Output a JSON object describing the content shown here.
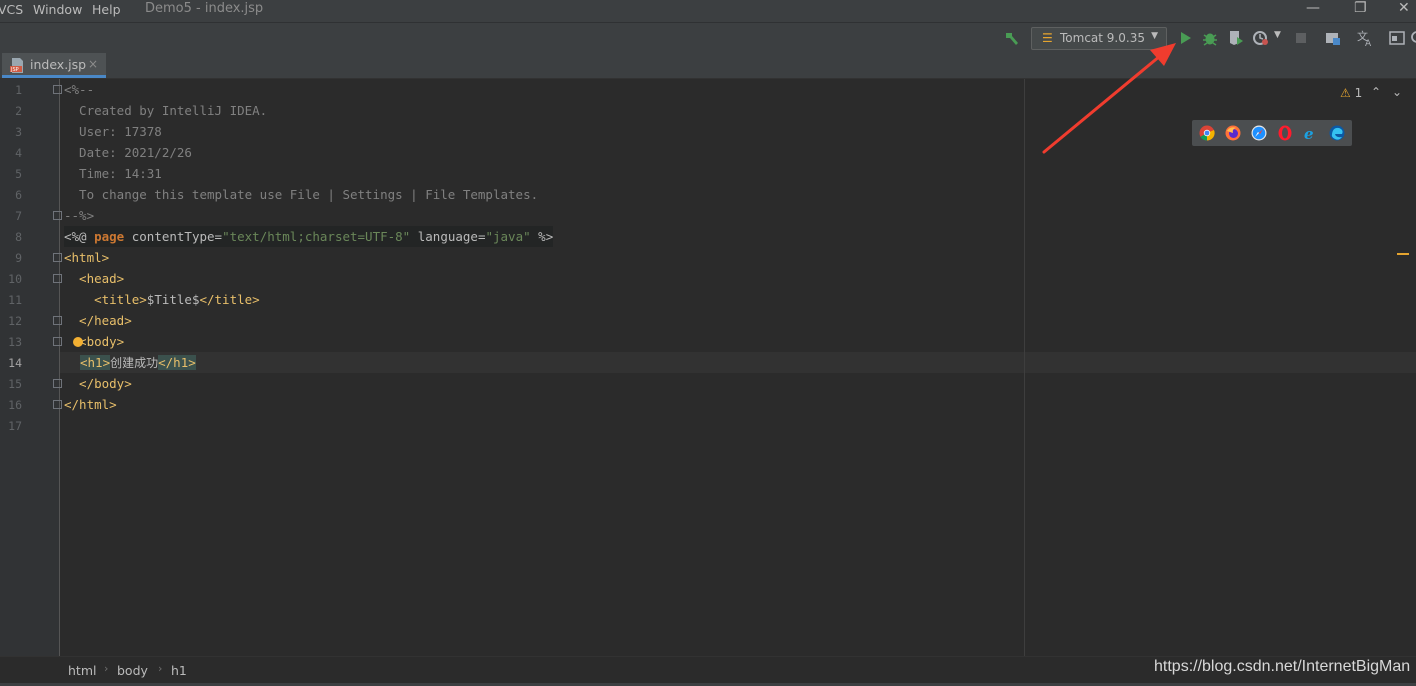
{
  "menubar": {
    "items": [
      "VCS",
      "Window",
      "Help"
    ],
    "title": "Demo5 - index.jsp"
  },
  "toolbar": {
    "run_config": "Tomcat 9.0.35",
    "icons": [
      "build-icon",
      "run-icon",
      "debug-icon",
      "coverage-icon",
      "profile-icon",
      "stop-icon",
      "project-structure-icon",
      "translate-icon",
      "terminal-icon"
    ]
  },
  "tabs": [
    {
      "label": "index.jsp",
      "close": "×",
      "icon_text": "JSP"
    }
  ],
  "editor": {
    "line_numbers": [
      "1",
      "2",
      "3",
      "4",
      "5",
      "6",
      "7",
      "8",
      "9",
      "10",
      "11",
      "12",
      "13",
      "14",
      "15",
      "16",
      "17"
    ],
    "current_line": "14",
    "lines": {
      "l1": "<%--",
      "l2": "  Created by IntelliJ IDEA.",
      "l3": "  User: 17378",
      "l4": "  Date: 2021/2/26",
      "l5": "  Time: 14:31",
      "l6": "  To change this template use File | Settings | File Templates.",
      "l7": "--%>",
      "l8_open": "<%@ ",
      "l8_page": "page",
      "l8_attr1": " contentType=",
      "l8_val1": "\"text/html;charset=UTF-8\"",
      "l8_attr2": " language=",
      "l8_val2": "\"java\"",
      "l8_close": " %>",
      "l9": "<html>",
      "l10": "  <head>",
      "l11_open": "    <title>",
      "l11_text": "$Title$",
      "l11_close": "</title>",
      "l12": "  </head>",
      "l13": "  <body>",
      "l14_open": "<h1>",
      "l14_text": "创建成功",
      "l14_close": "</h1>",
      "l15": "  </body>",
      "l16": "</html>"
    }
  },
  "inspections": {
    "warnings": "1",
    "up": "⌃",
    "down": "⌄"
  },
  "browsers": [
    "chrome-icon",
    "firefox-icon",
    "safari-icon",
    "opera-icon",
    "ie-icon",
    "edge-icon"
  ],
  "breadcrumb": [
    "html",
    "body",
    "h1"
  ],
  "watermark": "https://blog.csdn.net/InternetBigMan",
  "colors": {
    "background": "#2b2b2b",
    "gutter": "#313335",
    "tag": "#e8bf6a",
    "comment": "#808080",
    "string": "#6a8759",
    "keyword": "#cc7832",
    "run_green": "#499c54",
    "arrow_red": "#f03c2e"
  }
}
